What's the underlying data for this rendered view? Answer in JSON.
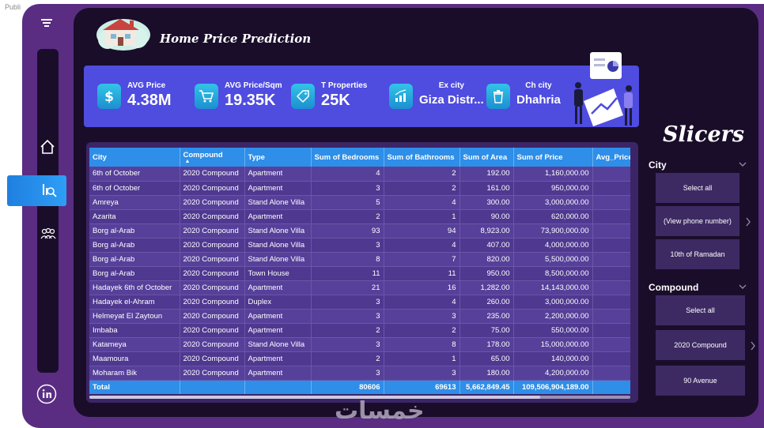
{
  "top_label": "Publi",
  "report": {
    "title": "Home Price Prediction"
  },
  "kpis": [
    {
      "label": "AVG Price",
      "value": "4.38M",
      "icon": "dollar-icon"
    },
    {
      "label": "AVG Price/Sqm",
      "value": "19.35K",
      "icon": "cart-icon"
    },
    {
      "label": "T Properties",
      "value": "25K",
      "icon": "tag-icon"
    },
    {
      "label": "Ex city",
      "value": "Giza Distr...",
      "icon": "growth-chart-icon"
    },
    {
      "label": "Ch city",
      "value": "Dhahria",
      "icon": "trash-icon"
    }
  ],
  "table": {
    "columns": [
      "City",
      "Compound",
      "Type",
      "Sum of Bedrooms",
      "Sum of Bathrooms",
      "Sum of Area",
      "Sum of Price",
      "Avg_Price"
    ],
    "rows": [
      [
        "6th of October",
        "2020 Compound",
        "Apartment",
        "4",
        "2",
        "192.00",
        "1,160,000.00"
      ],
      [
        "6th of October",
        "2020 Compound",
        "Apartment",
        "3",
        "2",
        "161.00",
        "950,000.00"
      ],
      [
        "Amreya",
        "2020 Compound",
        "Stand Alone Villa",
        "5",
        "4",
        "300.00",
        "3,000,000.00"
      ],
      [
        "Azarita",
        "2020 Compound",
        "Apartment",
        "2",
        "1",
        "90.00",
        "620,000.00"
      ],
      [
        "Borg al-Arab",
        "2020 Compound",
        "Stand Alone Villa",
        "93",
        "94",
        "8,923.00",
        "73,900,000.00"
      ],
      [
        "Borg al-Arab",
        "2020 Compound",
        "Stand Alone Villa",
        "3",
        "4",
        "407.00",
        "4,000,000.00"
      ],
      [
        "Borg al-Arab",
        "2020 Compound",
        "Stand Alone Villa",
        "8",
        "7",
        "820.00",
        "5,500,000.00"
      ],
      [
        "Borg al-Arab",
        "2020 Compound",
        "Town House",
        "11",
        "11",
        "950.00",
        "8,500,000.00"
      ],
      [
        "Hadayek 6th of October",
        "2020 Compound",
        "Apartment",
        "21",
        "16",
        "1,282.00",
        "14,143,000.00"
      ],
      [
        "Hadayek el-Ahram",
        "2020 Compound",
        "Duplex",
        "3",
        "4",
        "260.00",
        "3,000,000.00"
      ],
      [
        "Helmeyat El Zaytoun",
        "2020 Compound",
        "Apartment",
        "3",
        "3",
        "235.00",
        "2,200,000.00"
      ],
      [
        "Imbaba",
        "2020 Compound",
        "Apartment",
        "2",
        "2",
        "75.00",
        "550,000.00"
      ],
      [
        "Katameya",
        "2020 Compound",
        "Stand Alone Villa",
        "3",
        "8",
        "178.00",
        "15,000,000.00"
      ],
      [
        "Maamoura",
        "2020 Compound",
        "Apartment",
        "2",
        "1",
        "65.00",
        "140,000.00"
      ],
      [
        "Moharam Bik",
        "2020 Compound",
        "Apartment",
        "3",
        "3",
        "180.00",
        "4,200,000.00"
      ]
    ],
    "total": {
      "label": "Total",
      "bedrooms": "80606",
      "bathrooms": "69613",
      "area": "5,662,849.45",
      "price": "109,506,904,189.00"
    }
  },
  "slicers": {
    "title": "Slicers",
    "city": {
      "label": "City",
      "options": [
        "Select all",
        "(View phone number)",
        "10th of Ramadan"
      ]
    },
    "compound": {
      "label": "Compound",
      "options": [
        "Select all",
        "2020 Compound",
        "90 Avenue"
      ]
    }
  },
  "watermark": "خمسات",
  "colors": {
    "frame": "#5a2d82",
    "panel": "#1a0d2a",
    "kpi_band": "#4f4ce0",
    "table_header": "#2e8ee8",
    "accent": "#2e9ef5"
  }
}
